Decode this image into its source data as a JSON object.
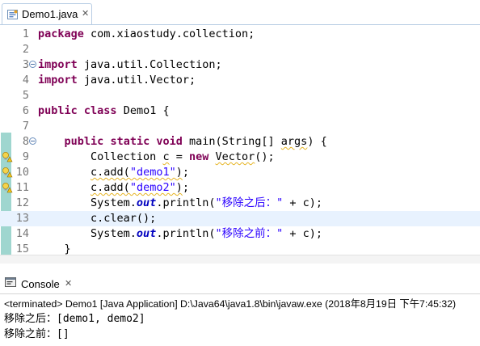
{
  "editor_tab": {
    "title": "Demo1.java",
    "close": "✕",
    "icon": "java-file-icon"
  },
  "code_lines": [
    {
      "num": "1",
      "text": "package com.xiaostudy.collection;"
    },
    {
      "num": "2",
      "text": ""
    },
    {
      "num": "3",
      "text": "import java.util.Collection;"
    },
    {
      "num": "4",
      "text": "import java.util.Vector;"
    },
    {
      "num": "5",
      "text": ""
    },
    {
      "num": "6",
      "text": "public class Demo1 {"
    },
    {
      "num": "7",
      "text": ""
    },
    {
      "num": "8",
      "text": "    public static void main(String[] args) {"
    },
    {
      "num": "9",
      "text": "        Collection c = new Vector();"
    },
    {
      "num": "10",
      "text": "        c.add(\"demo1\");"
    },
    {
      "num": "11",
      "text": "        c.add(\"demo2\");"
    },
    {
      "num": "12",
      "text": "        System.out.println(\"移除之后：\" + c);"
    },
    {
      "num": "13",
      "text": "        c.clear();"
    },
    {
      "num": "14",
      "text": "        System.out.println(\"移除之前：\" + c);"
    },
    {
      "num": "15",
      "text": "    }"
    }
  ],
  "current_line": 13,
  "colors": {
    "keyword": "#7f0055",
    "string": "#2a00ff",
    "field": "#0000c0",
    "current_line": "#e8f2fe",
    "change_bar": "#9fd6cf"
  },
  "console_view": {
    "tab_label": "Console",
    "close": "✕",
    "icon": "console-icon",
    "status": "<terminated> Demo1 [Java Application] D:\\Java64\\java1.8\\bin\\javaw.exe (2018年8月19日 下午7:45:32)",
    "output": [
      "移除之后：[demo1, demo2]",
      "移除之前：[]"
    ]
  }
}
